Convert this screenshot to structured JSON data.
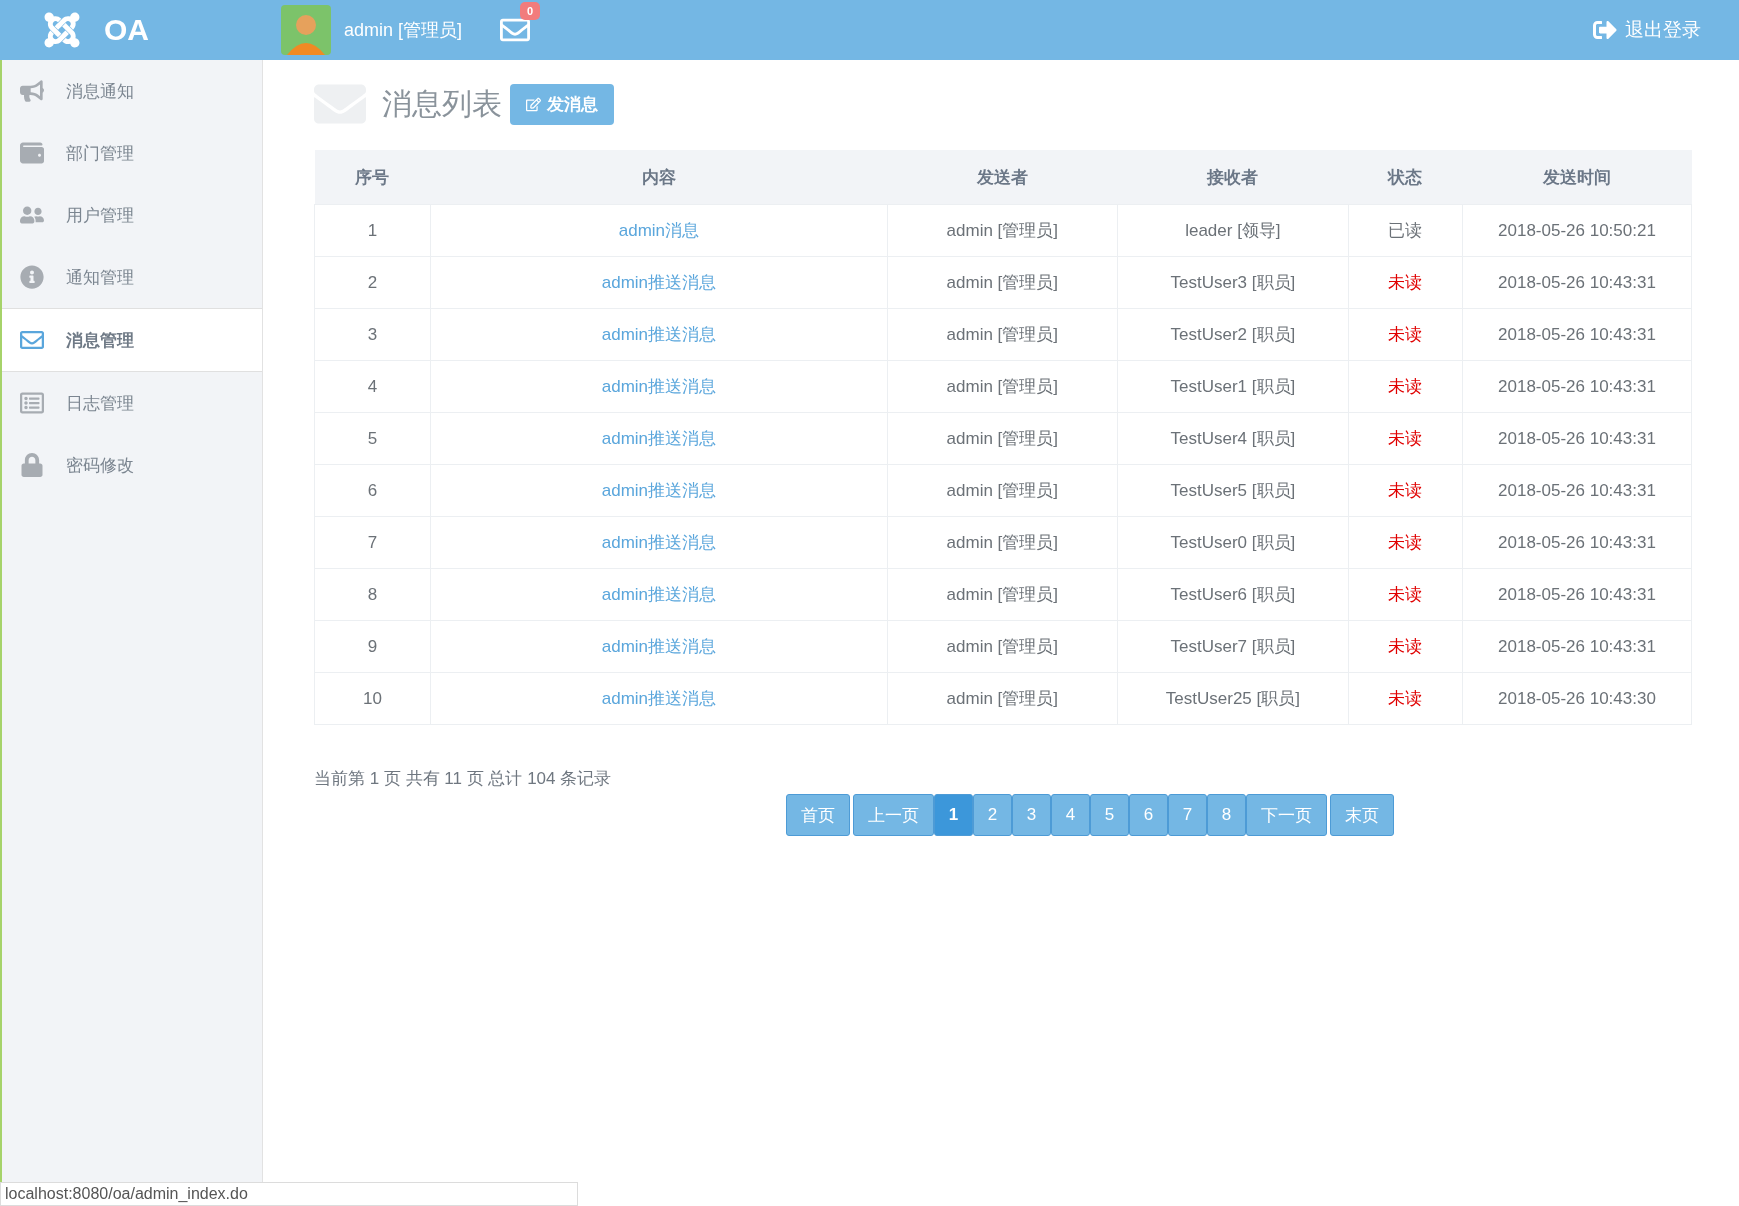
{
  "header": {
    "logo": "OA",
    "user": "admin [管理员]",
    "mail_count": "0",
    "logout": "退出登录"
  },
  "sidebar": {
    "items": [
      {
        "label": "消息通知",
        "selected": false
      },
      {
        "label": "部门管理",
        "selected": false
      },
      {
        "label": "用户管理",
        "selected": false
      },
      {
        "label": "通知管理",
        "selected": false
      },
      {
        "label": "消息管理",
        "selected": true
      },
      {
        "label": "日志管理",
        "selected": false
      },
      {
        "label": "密码修改",
        "selected": false
      }
    ]
  },
  "page": {
    "title": "消息列表",
    "new_button": "发消息"
  },
  "table": {
    "columns": [
      "序号",
      "内容",
      "发送者",
      "接收者",
      "状态",
      "发送时间"
    ],
    "rows": [
      {
        "no": "1",
        "content": "admin消息",
        "sender": "admin [管理员]",
        "receiver": "leader [领导]",
        "status": "已读",
        "read": true,
        "time": "2018-05-26 10:50:21"
      },
      {
        "no": "2",
        "content": "admin推送消息",
        "sender": "admin [管理员]",
        "receiver": "TestUser3 [职员]",
        "status": "未读",
        "read": false,
        "time": "2018-05-26 10:43:31"
      },
      {
        "no": "3",
        "content": "admin推送消息",
        "sender": "admin [管理员]",
        "receiver": "TestUser2 [职员]",
        "status": "未读",
        "read": false,
        "time": "2018-05-26 10:43:31"
      },
      {
        "no": "4",
        "content": "admin推送消息",
        "sender": "admin [管理员]",
        "receiver": "TestUser1 [职员]",
        "status": "未读",
        "read": false,
        "time": "2018-05-26 10:43:31"
      },
      {
        "no": "5",
        "content": "admin推送消息",
        "sender": "admin [管理员]",
        "receiver": "TestUser4 [职员]",
        "status": "未读",
        "read": false,
        "time": "2018-05-26 10:43:31"
      },
      {
        "no": "6",
        "content": "admin推送消息",
        "sender": "admin [管理员]",
        "receiver": "TestUser5 [职员]",
        "status": "未读",
        "read": false,
        "time": "2018-05-26 10:43:31"
      },
      {
        "no": "7",
        "content": "admin推送消息",
        "sender": "admin [管理员]",
        "receiver": "TestUser0 [职员]",
        "status": "未读",
        "read": false,
        "time": "2018-05-26 10:43:31"
      },
      {
        "no": "8",
        "content": "admin推送消息",
        "sender": "admin [管理员]",
        "receiver": "TestUser6 [职员]",
        "status": "未读",
        "read": false,
        "time": "2018-05-26 10:43:31"
      },
      {
        "no": "9",
        "content": "admin推送消息",
        "sender": "admin [管理员]",
        "receiver": "TestUser7 [职员]",
        "status": "未读",
        "read": false,
        "time": "2018-05-26 10:43:31"
      },
      {
        "no": "10",
        "content": "admin推送消息",
        "sender": "admin [管理员]",
        "receiver": "TestUser25 [职员]",
        "status": "未读",
        "read": false,
        "time": "2018-05-26 10:43:30"
      }
    ]
  },
  "pagination": {
    "summary": "当前第 1 页 共有 11 页 总计 104 条记录",
    "first": "首页",
    "prev": "上一页",
    "pages": [
      {
        "label": "1",
        "selected": true
      },
      {
        "label": "2",
        "selected": false
      },
      {
        "label": "3",
        "selected": false
      },
      {
        "label": "4",
        "selected": false
      },
      {
        "label": "5",
        "selected": false
      },
      {
        "label": "6",
        "selected": false
      },
      {
        "label": "7",
        "selected": false
      },
      {
        "label": "8",
        "selected": false
      }
    ],
    "next": "下一页",
    "last": "末页"
  },
  "status_bar": {
    "url": "localhost:8080/oa/admin_index.do"
  }
}
